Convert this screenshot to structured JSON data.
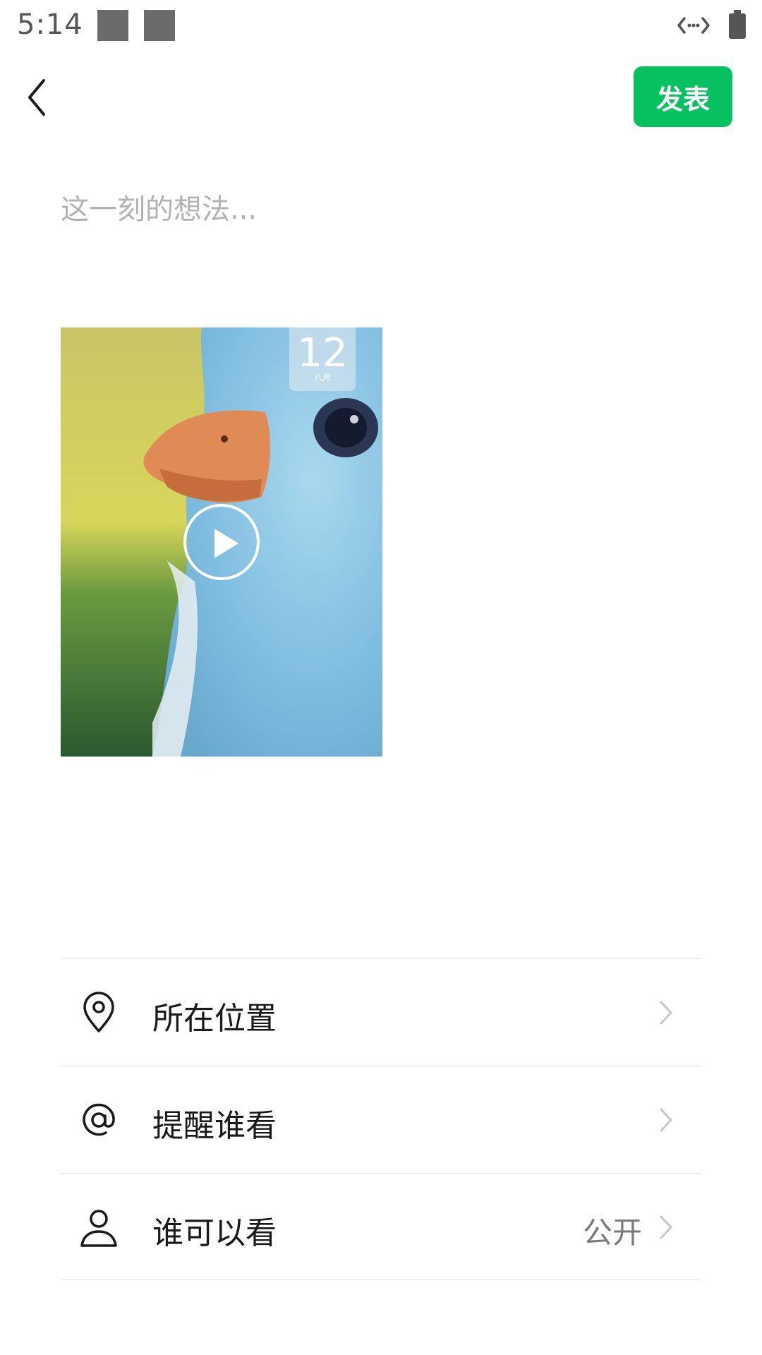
{
  "status_bar": {
    "time": "5:14",
    "icons": [
      "notification-icon",
      "notification-icon",
      "data-transfer-icon",
      "battery-icon"
    ]
  },
  "header": {
    "back_icon": "chevron-left-icon",
    "publish_label": "发表",
    "publish_color": "#07c160"
  },
  "composer": {
    "placeholder": "这一刻的想法..."
  },
  "media": {
    "type": "video",
    "overlay_icon": "play-icon",
    "calendar_day": "12",
    "calendar_month": "八月"
  },
  "options": [
    {
      "icon": "location-pin-icon",
      "label": "所在位置",
      "value": ""
    },
    {
      "icon": "at-sign-icon",
      "label": "提醒谁看",
      "value": ""
    },
    {
      "icon": "person-icon",
      "label": "谁可以看",
      "value": "公开"
    }
  ]
}
